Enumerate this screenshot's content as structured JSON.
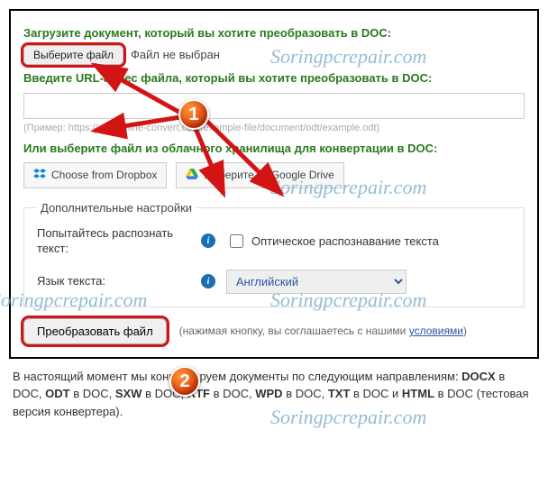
{
  "headings": {
    "upload": "Загрузите документ, который вы хотите преобразовать в DOC:",
    "url": "Введите URL-адрес файла, который вы хотите преобразовать в DOC:",
    "cloud": "Или выберите файл из облачного хранилища для конвертации в DOC:"
  },
  "file": {
    "choose_label": "Выберите файл",
    "status": "Файл не выбран"
  },
  "url_input": {
    "value": "",
    "example": "(Пример: https://cdn.online-convert.com/example-file/document/odt/example.odt)"
  },
  "cloud": {
    "dropbox_label": "Choose from Dropbox",
    "gdrive_label": "Выберите из Google Drive"
  },
  "extra": {
    "legend": "Дополнительные настройки",
    "ocr_label": "Попытайтесь распознать текст:",
    "ocr_check_label": "Оптическое распознавание текста",
    "lang_label": "Язык текста:",
    "lang_value": "Английский"
  },
  "convert": {
    "button_label": "Преобразовать файл",
    "agree_prefix": "(нажимая кнопку, вы соглашаетесь с нашими ",
    "agree_link": "условиями",
    "agree_suffix": ")"
  },
  "footer": {
    "text_before": "В настоящий момент мы конвертируем документы по следующим направлениям: ",
    "f1": "DOCX",
    "d1": " в DOC, ",
    "f2": "ODT",
    "d2": " в DOC, ",
    "f3": "SXW",
    "d3": " в DOC, ",
    "f4": "RTF",
    "d4": " в DOC, ",
    "f5": "WPD",
    "d5": " в DOC, ",
    "f6": "TXT",
    "d6": " в DOC и ",
    "f7": "HTML",
    "d7": " в DOC (тестовая версия конвертера)."
  },
  "watermark": "Soringpcrepair.com",
  "badges": {
    "one": "1",
    "two": "2"
  }
}
